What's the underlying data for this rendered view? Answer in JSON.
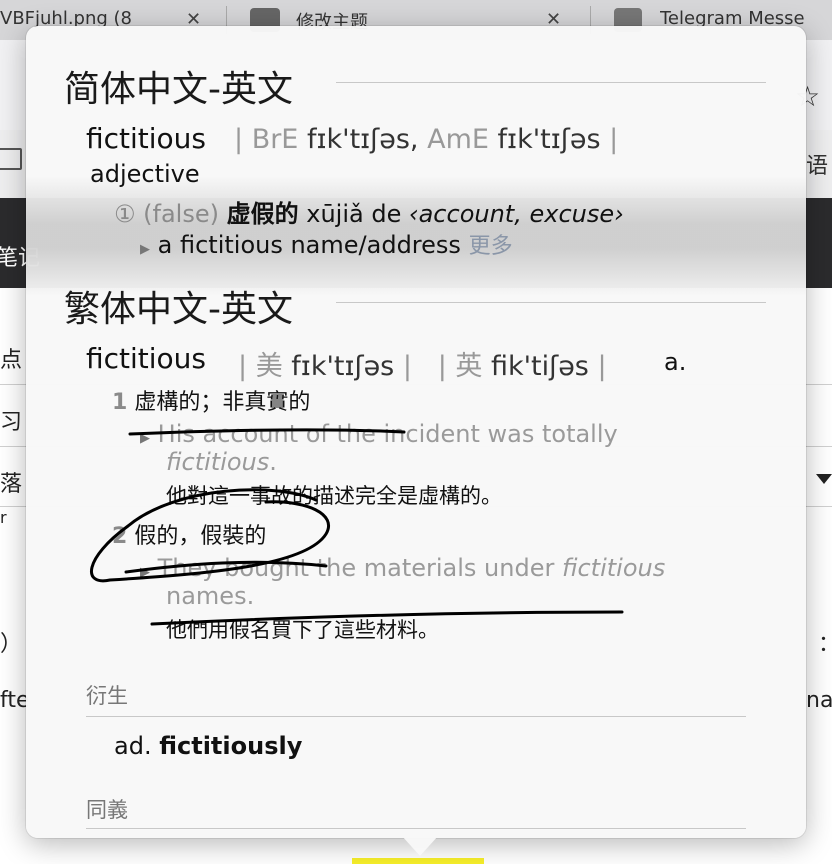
{
  "browser": {
    "tabs": [
      {
        "title": "VBFjuhl.png (8"
      },
      {
        "title": "修改主题"
      },
      {
        "title": "Telegram Messe"
      }
    ],
    "right_fragment": "语"
  },
  "background_fragments": {
    "dark_left": "笔记",
    "row1": "点",
    "row2": "习",
    "row3": "落",
    "row4": "r",
    "row5_left": "）",
    "row5_right": "：",
    "row6_left": "fte",
    "row6_right": "nal"
  },
  "dict": {
    "simplified": {
      "title": "简体中文-英文",
      "headword": "fictitious",
      "bre_label": "BrE",
      "bre_ipa": "fɪk'tɪʃəs,",
      "ame_label": "AmE",
      "ame_ipa": "fɪk'tɪʃəs",
      "pos": "adjective",
      "sense_num": "①",
      "sense_note": "(false)",
      "sense_zh": "虚假的",
      "sense_pinyin": "xūjiǎ de",
      "sense_context": "‹account, excuse›",
      "example": "a fictitious name/address",
      "more": "更多"
    },
    "traditional": {
      "title": "繁体中文-英文",
      "headword": "fictitious",
      "us_label": "美",
      "us_ipa": "fɪk'tɪʃəs",
      "uk_label": "英",
      "uk_ipa": "fik'tiʃəs",
      "pos": "a.",
      "senses": [
        {
          "num": "1",
          "zh": "虚構的；非真實的",
          "example_en_1": "His account of the incident was totally",
          "example_en_2": "fictitious",
          "example_en_2_end": ".",
          "example_zh": "他對這一事故的描述完全是虛構的。"
        },
        {
          "num": "2",
          "zh": "假的，假裝的",
          "example_en_1": "They bought the materials under",
          "example_en_1_it": "fictitious",
          "example_en_2": "names.",
          "example_zh": "他們用假名買下了這些材料。"
        }
      ],
      "derived_label": "衍生",
      "derived_pos": "ad.",
      "derived_word": "fictitiously",
      "synonyms_label": "同義"
    }
  },
  "colors": {
    "accent_yellow": "#f7ef2a",
    "ink": "#000000"
  }
}
